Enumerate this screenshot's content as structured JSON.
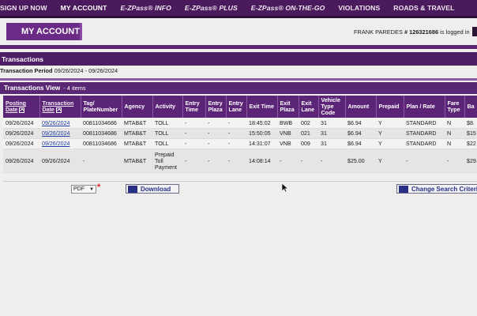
{
  "nav": {
    "items": [
      {
        "label": "SIGN UP NOW",
        "active": false,
        "italic": false
      },
      {
        "label": "MY ACCOUNT",
        "active": true,
        "italic": false
      },
      {
        "label": "E-ZPass® INFO",
        "active": false,
        "italic": true
      },
      {
        "label": "E-ZPass® PLUS",
        "active": false,
        "italic": true
      },
      {
        "label": "E-ZPass® ON-THE-GO",
        "active": false,
        "italic": true
      },
      {
        "label": "VIOLATIONS",
        "active": false,
        "italic": false
      },
      {
        "label": "ROADS & TRAVEL",
        "active": false,
        "italic": false
      }
    ]
  },
  "banner": {
    "title": "MY ACCOUNT"
  },
  "login": {
    "name": "FRANK PAREDES",
    "account": "# 126321686",
    "suffix": "is logged in"
  },
  "transactions": {
    "section_title": "Transactions",
    "period_label": "Transaction Period",
    "period_value": "09/26/2024 - 09/26/2024",
    "view_title": "Transactions View",
    "view_count": "- 4 items"
  },
  "table": {
    "columns": [
      {
        "label": "Posting Date",
        "link": true,
        "sort": true
      },
      {
        "label": "Transaction Date",
        "link": true,
        "sort": true
      },
      {
        "label": "Tag/ PlateNumber",
        "link": false,
        "sort": false
      },
      {
        "label": "Agency",
        "link": false,
        "sort": false
      },
      {
        "label": "Activity",
        "link": false,
        "sort": false
      },
      {
        "label": "Entry Time",
        "link": false,
        "sort": false
      },
      {
        "label": "Entry Plaza",
        "link": false,
        "sort": false
      },
      {
        "label": "Entry Lane",
        "link": false,
        "sort": false
      },
      {
        "label": "Exit Time",
        "link": false,
        "sort": false
      },
      {
        "label": "Exit Plaza",
        "link": false,
        "sort": false
      },
      {
        "label": "Exit Lane",
        "link": false,
        "sort": false
      },
      {
        "label": "Vehicle Type Code",
        "link": false,
        "sort": false
      },
      {
        "label": "Amount",
        "link": false,
        "sort": false
      },
      {
        "label": "Prepaid",
        "link": false,
        "sort": false
      },
      {
        "label": "Plan / Rate",
        "link": false,
        "sort": false
      },
      {
        "label": "Fare Type",
        "link": false,
        "sort": false
      },
      {
        "label": "Ba",
        "link": false,
        "sort": false
      }
    ],
    "rows": [
      [
        "09/26/2024",
        "09/26/2024",
        "00811034686",
        "MTAB&T",
        "TOLL",
        "-",
        "-",
        "-",
        "18:45:02",
        "BWB",
        "002",
        "31",
        "$6.94",
        "Y",
        "STANDARD",
        "N",
        "$8."
      ],
      [
        "09/26/2024",
        "09/26/2024",
        "00811034686",
        "MTAB&T",
        "TOLL",
        "-",
        "-",
        "-",
        "15:50:05",
        "VNB",
        "021",
        "31",
        "$6.94",
        "Y",
        "STANDARD",
        "N",
        "$15"
      ],
      [
        "09/26/2024",
        "09/26/2024",
        "00811034686",
        "MTAB&T",
        "TOLL",
        "-",
        "-",
        "-",
        "14:31:07",
        "VNB",
        "009",
        "31",
        "$6.94",
        "Y",
        "STANDARD",
        "N",
        "$22"
      ],
      [
        "09/26/2024",
        "09/26/2024",
        "-",
        "MTAB&T",
        "Prepaid Toll Payment",
        "-",
        "-",
        "-",
        "14:08:14",
        "-",
        "-",
        "-",
        "$25.00",
        "Y",
        "-",
        "-",
        "$29."
      ]
    ]
  },
  "export": {
    "format_value": "PDF",
    "download_label": "Download",
    "change_search_label": "Change Search Criteria"
  },
  "colors": {
    "nav_bg": "#4b1a5c",
    "header_bg": "#5b2477",
    "link": "#1f3ea3",
    "required": "#d22222"
  }
}
